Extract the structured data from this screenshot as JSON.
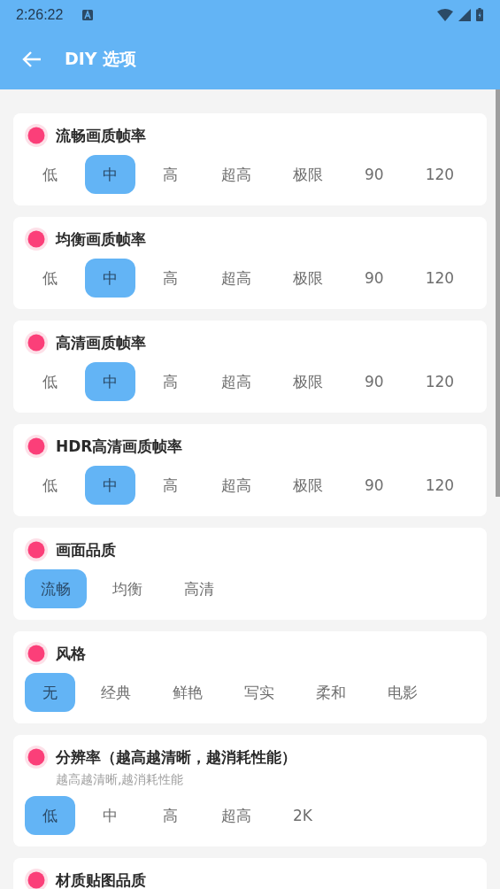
{
  "status_bar": {
    "time": "2:26:22"
  },
  "app_bar": {
    "title": "DIY 选项"
  },
  "sections": [
    {
      "title": "流畅画质帧率",
      "options": [
        {
          "label": "低",
          "selected": false
        },
        {
          "label": "中",
          "selected": true
        },
        {
          "label": "高",
          "selected": false
        },
        {
          "label": "超高",
          "selected": false
        },
        {
          "label": "极限",
          "selected": false
        },
        {
          "label": "90",
          "selected": false
        },
        {
          "label": "120",
          "selected": false
        }
      ]
    },
    {
      "title": "均衡画质帧率",
      "options": [
        {
          "label": "低",
          "selected": false
        },
        {
          "label": "中",
          "selected": true
        },
        {
          "label": "高",
          "selected": false
        },
        {
          "label": "超高",
          "selected": false
        },
        {
          "label": "极限",
          "selected": false
        },
        {
          "label": "90",
          "selected": false
        },
        {
          "label": "120",
          "selected": false
        }
      ]
    },
    {
      "title": "高清画质帧率",
      "options": [
        {
          "label": "低",
          "selected": false
        },
        {
          "label": "中",
          "selected": true
        },
        {
          "label": "高",
          "selected": false
        },
        {
          "label": "超高",
          "selected": false
        },
        {
          "label": "极限",
          "selected": false
        },
        {
          "label": "90",
          "selected": false
        },
        {
          "label": "120",
          "selected": false
        }
      ]
    },
    {
      "title": "HDR高清画质帧率",
      "options": [
        {
          "label": "低",
          "selected": false
        },
        {
          "label": "中",
          "selected": true
        },
        {
          "label": "高",
          "selected": false
        },
        {
          "label": "超高",
          "selected": false
        },
        {
          "label": "极限",
          "selected": false
        },
        {
          "label": "90",
          "selected": false
        },
        {
          "label": "120",
          "selected": false
        }
      ]
    },
    {
      "title": "画面品质",
      "options": [
        {
          "label": "流畅",
          "selected": true
        },
        {
          "label": "均衡",
          "selected": false
        },
        {
          "label": "高清",
          "selected": false
        }
      ]
    },
    {
      "title": "风格",
      "options": [
        {
          "label": "无",
          "selected": true
        },
        {
          "label": "经典",
          "selected": false
        },
        {
          "label": "鲜艳",
          "selected": false
        },
        {
          "label": "写实",
          "selected": false
        },
        {
          "label": "柔和",
          "selected": false
        },
        {
          "label": "电影",
          "selected": false
        }
      ]
    },
    {
      "title": "分辨率（越高越清晰，越消耗性能）",
      "subtitle": "越高越清晰,越消耗性能",
      "options": [
        {
          "label": "低",
          "selected": true
        },
        {
          "label": "中",
          "selected": false
        },
        {
          "label": "高",
          "selected": false
        },
        {
          "label": "超高",
          "selected": false
        },
        {
          "label": "2K",
          "selected": false
        }
      ]
    },
    {
      "title": "材质贴图品质"
    }
  ]
}
